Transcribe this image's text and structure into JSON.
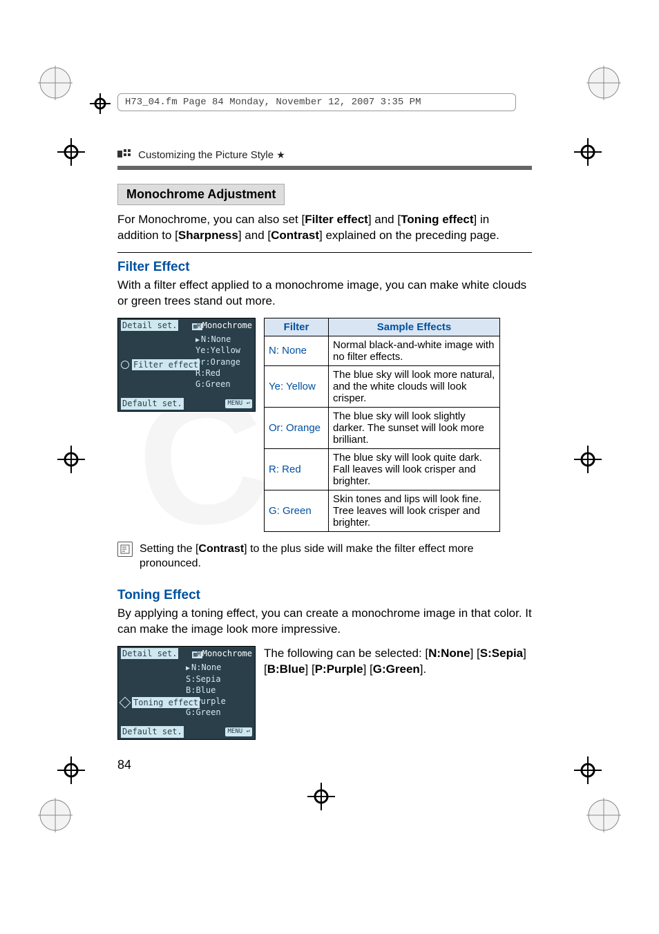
{
  "frame_header": "H73_04.fm  Page 84  Monday, November 12, 2007  3:35 PM",
  "running_head": {
    "text": "Customizing the Picture Style",
    "star": "★"
  },
  "section_title": "Monochrome Adjustment",
  "intro": {
    "pre": "For Monochrome, you can also set [",
    "b1": "Filter effect",
    "mid1": "] and [",
    "b2": "Toning effect",
    "mid2": "] in addition to [",
    "b3": "Sharpness",
    "mid3": "] and [",
    "b4": "Contrast",
    "post": "] explained on the preceding page."
  },
  "filter": {
    "heading": "Filter Effect",
    "desc": "With a filter effect applied to a monochrome image, you can make white clouds or green trees stand out more.",
    "lcd": {
      "title_left": "Detail set.",
      "title_right": "Monochrome",
      "label": "Filter effect",
      "options": [
        "N:None",
        "Ye:Yellow",
        "Or:Orange",
        "R:Red",
        "G:Green"
      ],
      "footer_left": "Default set.",
      "footer_right": "MENU ↩"
    },
    "table": {
      "head_filter": "Filter",
      "head_effect": "Sample Effects",
      "rows": [
        {
          "filter": "N: None",
          "effect": "Normal black-and-white image with no filter effects."
        },
        {
          "filter": "Ye: Yellow",
          "effect": "The blue sky will look more natural, and the white clouds will look crisper."
        },
        {
          "filter": "Or: Orange",
          "effect": "The blue sky will look slightly darker. The sunset will look more brilliant."
        },
        {
          "filter": "R: Red",
          "effect": "The blue sky will look quite dark. Fall leaves will look crisper and brighter."
        },
        {
          "filter": "G: Green",
          "effect": "Skin tones and lips will look fine. Tree leaves will look crisper and brighter."
        }
      ]
    },
    "note": {
      "pre": "Setting the [",
      "bold": "Contrast",
      "post": "] to the plus side will make the filter effect more pronounced."
    }
  },
  "toning": {
    "heading": "Toning Effect",
    "desc": "By applying a toning effect, you can create a monochrome image in that color. It can make the image look more impressive.",
    "lcd": {
      "title_left": "Detail set.",
      "title_right": "Monochrome",
      "label": "Toning effect",
      "options": [
        "N:None",
        "S:Sepia",
        "B:Blue",
        "P:Purple",
        "G:Green"
      ],
      "footer_left": "Default set.",
      "footer_right": "MENU ↩"
    },
    "select_text": {
      "pre": "The following can be selected: [",
      "o1": "N:None",
      "s1": "] [",
      "o2": "S:Sepia",
      "s2": "] [",
      "o3": "B:Blue",
      "s3": "] [",
      "o4": "P:Purple",
      "s4": "] [",
      "o5": "G:Green",
      "post": "]."
    }
  },
  "page_number": "84"
}
